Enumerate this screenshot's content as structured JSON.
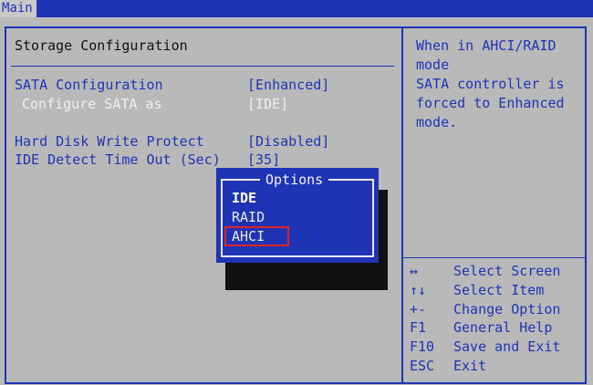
{
  "menu": {
    "tab": "Main"
  },
  "panel": {
    "title": "Storage Configuration"
  },
  "settings": [
    {
      "label": "SATA Configuration",
      "value": "[Enhanced]"
    },
    {
      "label": "Configure SATA as",
      "value": "[IDE]"
    },
    {
      "label": "Hard Disk Write Protect",
      "value": "[Disabled]"
    },
    {
      "label": "IDE Detect Time Out (Sec)",
      "value": "[35]"
    }
  ],
  "help": {
    "text": "When in AHCI/RAID mode\nSATA controller is\nforced to Enhanced\nmode."
  },
  "keys": [
    {
      "key": "↔",
      "desc": "Select Screen"
    },
    {
      "key": "↑↓",
      "desc": "Select Item"
    },
    {
      "key": "+-",
      "desc": "Change Option"
    },
    {
      "key": "F1",
      "desc": "General Help"
    },
    {
      "key": "F10",
      "desc": "Save and Exit"
    },
    {
      "key": "ESC",
      "desc": "Exit"
    }
  ],
  "popup": {
    "title": "Options",
    "options": [
      "IDE",
      "RAID",
      "AHCI"
    ],
    "current": "IDE",
    "highlighted": "AHCI"
  },
  "colors": {
    "bios_blue": "#1f34b4",
    "background": "#b9b9b9",
    "highlight_red": "#e0222a"
  }
}
